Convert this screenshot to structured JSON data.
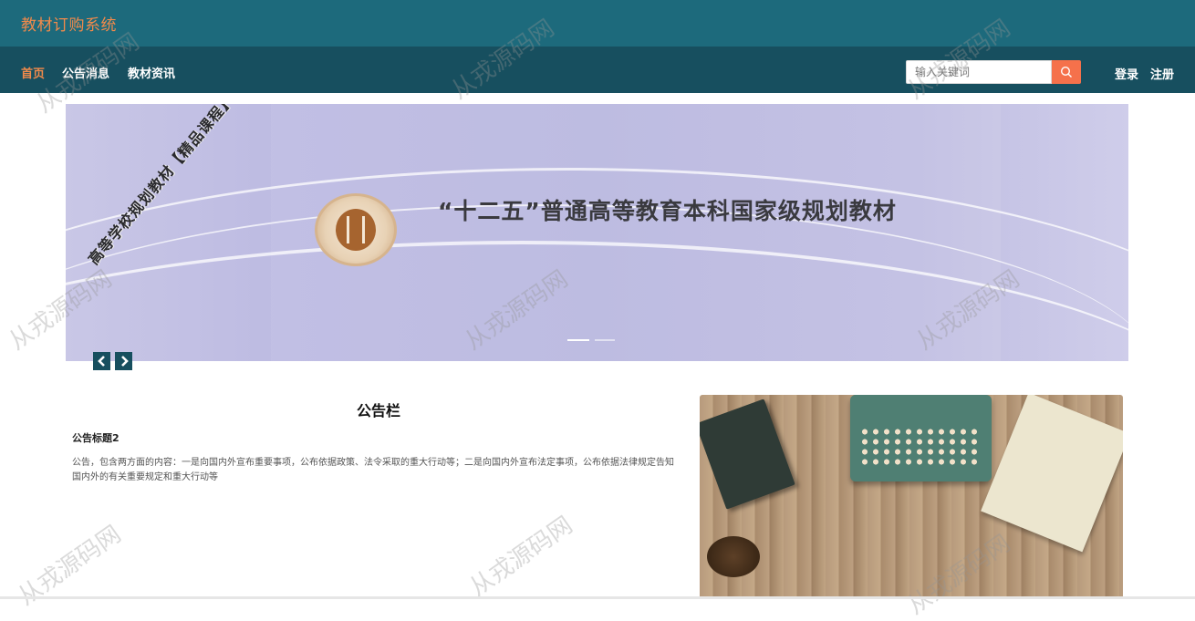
{
  "header": {
    "site_title": "教材订购系统"
  },
  "nav": {
    "items": [
      {
        "label": "首页",
        "active": true
      },
      {
        "label": "公告消息",
        "active": false
      },
      {
        "label": "教材资讯",
        "active": false
      }
    ]
  },
  "search": {
    "placeholder": "输入关键词",
    "button_icon": "search-icon"
  },
  "auth": {
    "login_label": "登录",
    "register_label": "注册"
  },
  "banner": {
    "headline": "“十二五”普通高等教育本科国家级规划教材",
    "stamp_text": "高等学校规划教材【精品课程】",
    "slide_count": 2,
    "active_slide": 1,
    "prev_icon": "chevron-left-icon",
    "next_icon": "chevron-right-icon"
  },
  "notice": {
    "section_title": "公告栏",
    "item_title": "公告标题2",
    "item_body": "公告，包含两方面的内容：一是向国内外宣布重要事项，公布依据政策、法令采取的重大行动等；二是向国内外宣布法定事项，公布依据法律规定告知国内外的有关重要规定和重大行动等"
  },
  "watermark": {
    "text": "从戎源码网"
  },
  "colors": {
    "header_bg": "#1d6a7c",
    "nav_bg": "#174f5f",
    "accent": "#f08a4b",
    "search_button": "#f5714b"
  }
}
